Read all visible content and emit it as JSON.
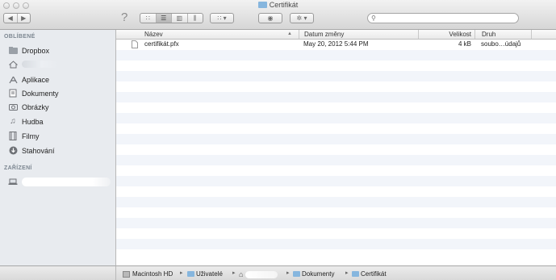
{
  "window": {
    "title": "Certifikát"
  },
  "toolbar": {
    "back": "◀",
    "forward": "▶",
    "help": "?",
    "view_icons": "∷",
    "view_list": "☰",
    "view_columns": "▥",
    "view_coverflow": "⫼",
    "arrange": "∷ ▾",
    "quicklook": "◉",
    "action": "✲ ▾",
    "search_placeholder": ""
  },
  "sidebar": {
    "favorites_header": "OBLÍBENÉ",
    "devices_header": "ZAŘÍZENÍ",
    "items": [
      {
        "label": "Dropbox",
        "icon": "folder-icon"
      },
      {
        "label": "",
        "icon": "home-icon"
      },
      {
        "label": "Aplikace",
        "icon": "applications-icon"
      },
      {
        "label": "Dokumenty",
        "icon": "documents-icon"
      },
      {
        "label": "Obrázky",
        "icon": "camera-icon"
      },
      {
        "label": "Hudba",
        "icon": "music-note-icon"
      },
      {
        "label": "Filmy",
        "icon": "film-icon"
      },
      {
        "label": "Stahování",
        "icon": "download-icon"
      }
    ],
    "devices": [
      {
        "label": "",
        "icon": "laptop-icon"
      }
    ]
  },
  "columns": {
    "name": "Název",
    "date": "Datum změny",
    "size": "Velikost",
    "kind": "Druh"
  },
  "files": [
    {
      "name": "certifikát.pfx",
      "date": "May 20, 2012 5:44 PM",
      "size": "4 kB",
      "kind": "soubo…údajů"
    }
  ],
  "pathbar": {
    "items": [
      "Macintosh HD",
      "Uživatelé",
      "",
      "Dokumenty",
      "Certifikát"
    ]
  }
}
